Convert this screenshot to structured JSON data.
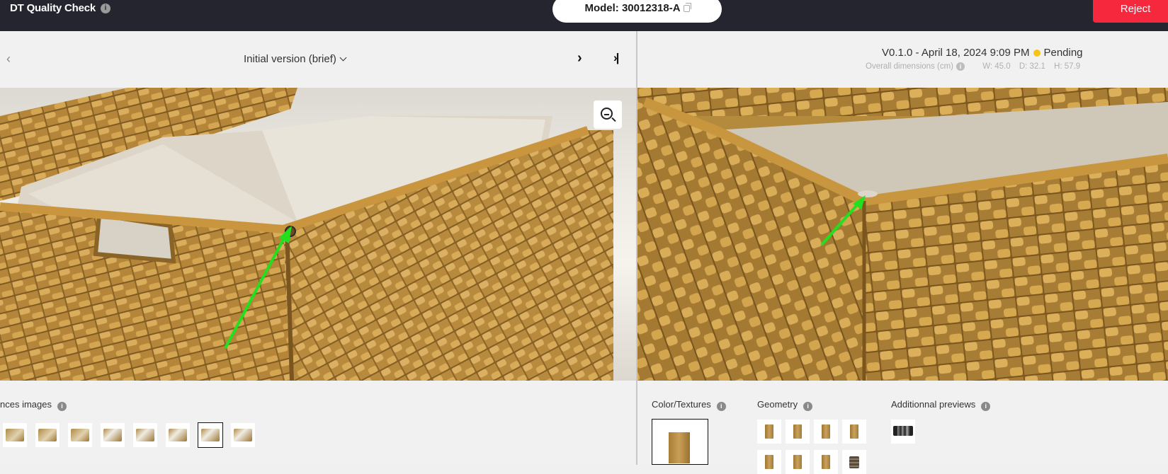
{
  "header": {
    "app_title": "DT Quality Check",
    "model_label": "Model: 30012318-A",
    "reject_label": "Reject"
  },
  "left": {
    "version_select": "Initial version (brief)",
    "references_label": "nces images",
    "reference_thumbs": [
      "ref-1",
      "ref-2",
      "ref-3",
      "ref-4",
      "ref-5",
      "ref-6",
      "ref-7",
      "ref-8"
    ],
    "selected_thumb": 6
  },
  "right": {
    "version_line": "V0.1.0 - April 18, 2024 9:09 PM",
    "status": "Pending",
    "status_color": "#f5c518",
    "dims_label": "Overall dimensions (cm)",
    "width": "W: 45.0",
    "depth": "D: 32.1",
    "height": "H: 57.9",
    "color_textures_label": "Color/Textures",
    "geometry_label": "Geometry",
    "additional_label": "Additionnal previews"
  },
  "colors": {
    "topbar": "#24252f",
    "reject": "#f5283e",
    "arrow": "#22e01e",
    "wicker": "#c49a48"
  },
  "icons": {
    "info": "info-icon",
    "copy": "copy-icon",
    "zoom": "zoom-out-icon",
    "prev": "chevron-left-icon",
    "next": "chevron-right-icon",
    "last": "skip-to-end-icon",
    "dropdown": "chevron-down-icon"
  }
}
